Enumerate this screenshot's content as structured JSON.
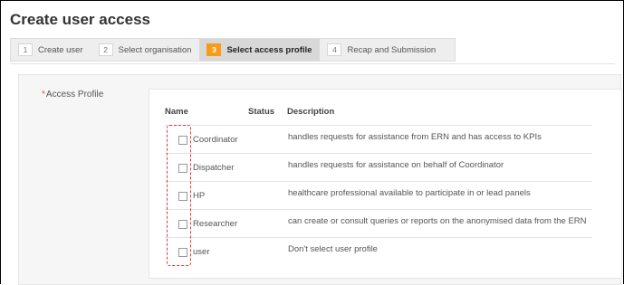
{
  "page": {
    "title": "Create user access"
  },
  "wizard": {
    "steps": [
      {
        "number": "1",
        "label": "Create user"
      },
      {
        "number": "2",
        "label": "Select organisation"
      },
      {
        "number": "3",
        "label": "Select access profile"
      },
      {
        "number": "4",
        "label": "Recap and Submission"
      }
    ],
    "active_step": 3
  },
  "form": {
    "access_profile": {
      "required_marker": "*",
      "label": "Access Profile",
      "columns": {
        "name": "Name",
        "status": "Status",
        "description": "Description"
      },
      "rows": [
        {
          "name": "Coordinator",
          "status": "",
          "description": "handles requests for assistance from ERN and has access to KPIs",
          "checked": false
        },
        {
          "name": "Dispatcher",
          "status": "",
          "description": "handles requests for assistance on behalf of Coordinator",
          "checked": false
        },
        {
          "name": "HP",
          "status": "",
          "description": "healthcare professional available to participate in or lead panels",
          "checked": false
        },
        {
          "name": "Researcher",
          "status": "",
          "description": "can create or consult queries or reports on the anonymised data from the ERN",
          "checked": false
        },
        {
          "name": "user",
          "status": "",
          "description": "Don't select user profile",
          "checked": false
        }
      ]
    }
  },
  "colors": {
    "active_step": "#f59c1a",
    "highlight": "#e8352f",
    "required": "#d9534f"
  }
}
